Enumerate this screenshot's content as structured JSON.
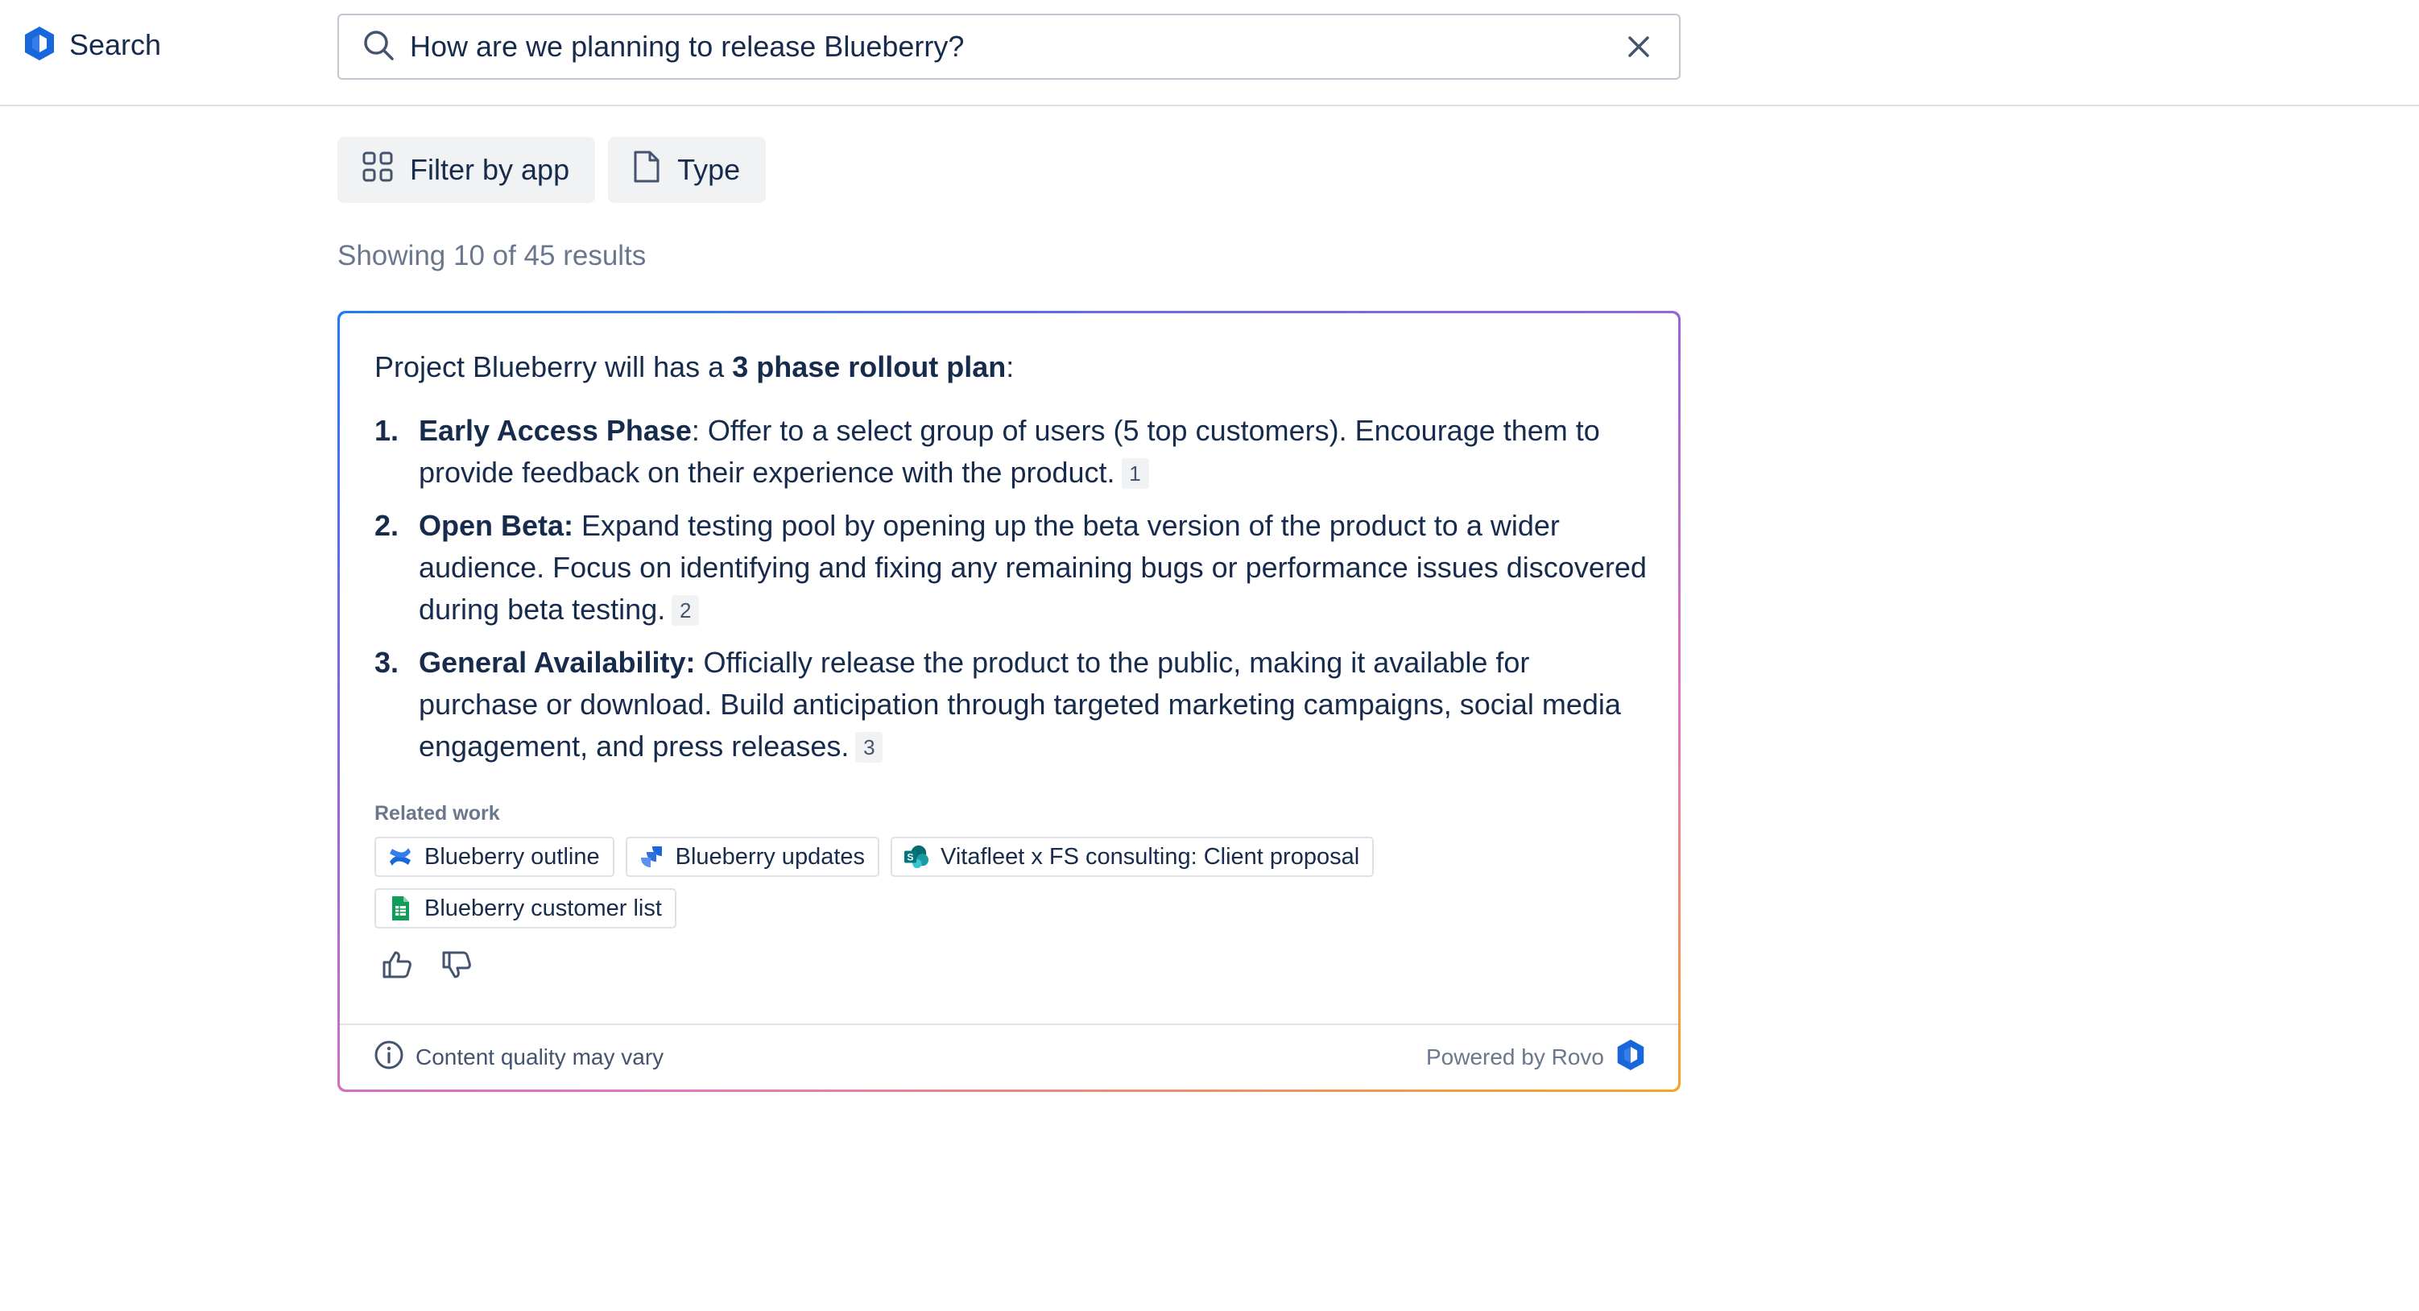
{
  "app": {
    "title": "Search",
    "brand_color": "#1868db"
  },
  "search": {
    "value": "How are we planning to release Blueberry?",
    "placeholder": "Search"
  },
  "filters": [
    {
      "label": "Filter by app",
      "icon": "grid-icon"
    },
    {
      "label": "Type",
      "icon": "document-icon"
    }
  ],
  "results": {
    "count_text": "Showing 10 of 45 results"
  },
  "answer": {
    "intro_prefix": "Project Blueberry will has a ",
    "intro_bold": "3 phase rollout plan",
    "intro_suffix": ":",
    "phases": [
      {
        "number": "1.",
        "title": "Early Access Phase",
        "title_suffix": ": ",
        "text": "Offer to a select group of users (5 top customers). Encourage them to provide feedback on their experience with the product.",
        "citation": "1"
      },
      {
        "number": "2.",
        "title": "Open Beta:",
        "title_suffix": " ",
        "text": "Expand testing pool by opening up the beta version of the product to a wider audience. Focus on identifying and fixing any remaining bugs or performance issues discovered during beta testing.",
        "citation": "2"
      },
      {
        "number": "3.",
        "title": "General Availability:",
        "title_suffix": " ",
        "text": "Officially release the product to the public, making it available for purchase or download. Build anticipation through targeted marketing campaigns, social media engagement, and press releases.",
        "citation": "3"
      }
    ],
    "related_label": "Related work",
    "related": [
      {
        "label": "Blueberry outline",
        "icon": "confluence-icon"
      },
      {
        "label": "Blueberry updates",
        "icon": "jira-icon"
      },
      {
        "label": "Vitafleet x FS consulting: Client proposal",
        "icon": "sharepoint-icon"
      },
      {
        "label": "Blueberry customer list",
        "icon": "google-sheets-icon"
      }
    ],
    "footer_note": "Content quality may vary",
    "powered_by": "Powered by Rovo"
  }
}
